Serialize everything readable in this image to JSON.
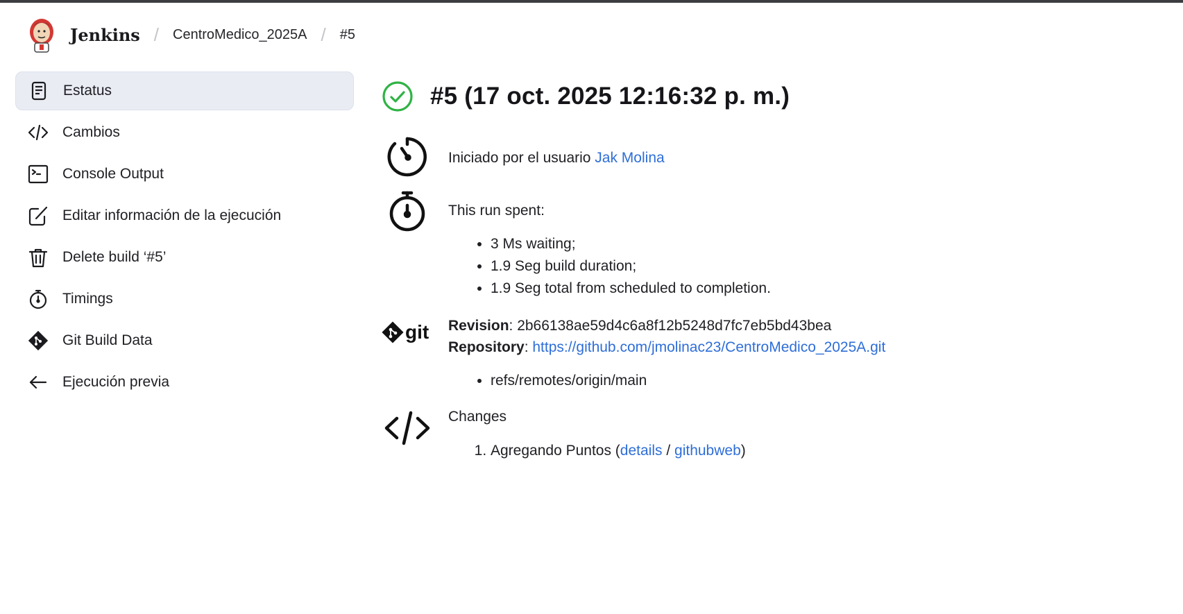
{
  "header": {
    "brand": "Jenkins",
    "breadcrumbs": [
      "CentroMedico_2025A",
      "#5"
    ]
  },
  "sidebar": {
    "items": [
      {
        "label": "Estatus",
        "icon": "document-icon",
        "active": true
      },
      {
        "label": "Cambios",
        "icon": "code-icon"
      },
      {
        "label": "Console Output",
        "icon": "terminal-icon"
      },
      {
        "label": "Editar información de la ejecución",
        "icon": "edit-icon"
      },
      {
        "label": "Delete build ‘#5’",
        "icon": "trash-icon"
      },
      {
        "label": "Timings",
        "icon": "stopwatch-icon"
      },
      {
        "label": "Git Build Data",
        "icon": "git-icon"
      },
      {
        "label": "Ejecución previa",
        "icon": "arrow-left-icon"
      }
    ]
  },
  "main": {
    "title": "#5 (17 oct. 2025 12:16:32 p. m.)",
    "status": "success",
    "started": {
      "prefix": "Iniciado por el usuario ",
      "user": "Jak Molina"
    },
    "timing": {
      "heading": "This run spent:",
      "items": [
        "3 Ms waiting;",
        "1.9 Seg build duration;",
        "1.9 Seg total from scheduled to completion."
      ]
    },
    "git": {
      "logo_text": "git",
      "revision_label": "Revision",
      "revision": "2b66138ae59d4c6a8f12b5248d7fc7eb5bd43bea",
      "repository_label": "Repository",
      "repository": "https://github.com/jmolinac23/CentroMedico_2025A.git",
      "refs": [
        "refs/remotes/origin/main"
      ]
    },
    "changes": {
      "heading": "Changes",
      "items": [
        {
          "text": "Agregando Puntos",
          "details": "details",
          "githubweb": "githubweb"
        }
      ]
    }
  },
  "colors": {
    "accent_link": "#2e6ed8",
    "success": "#2fb344",
    "active_bg": "#e9ecf3"
  }
}
